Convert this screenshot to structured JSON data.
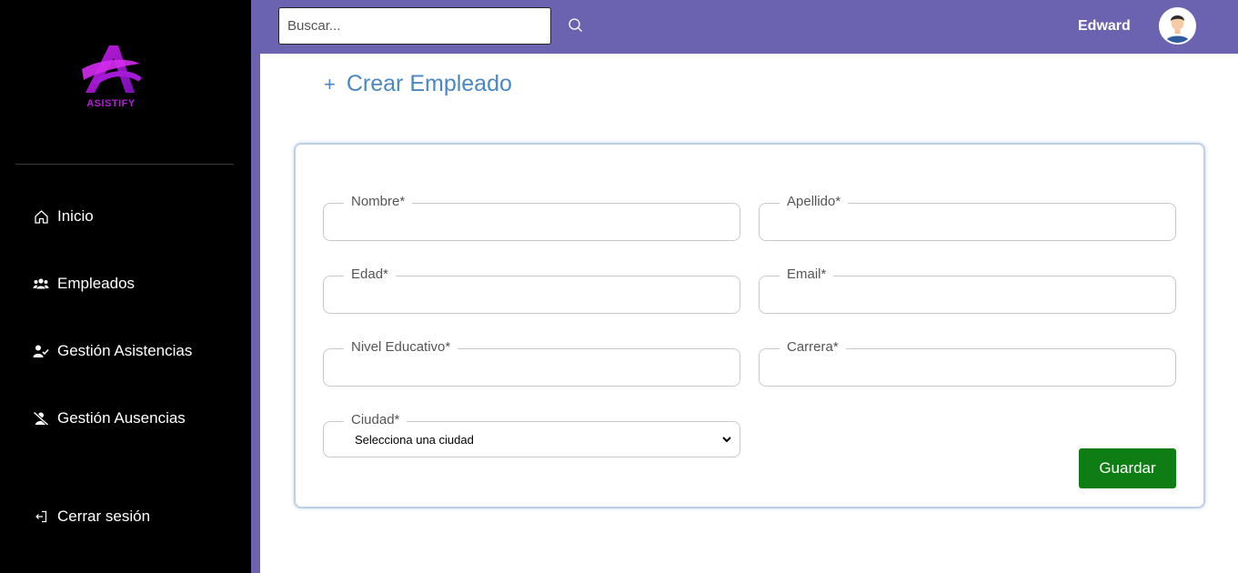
{
  "brand": {
    "name": "ASISTIFY"
  },
  "sidebar": {
    "items": [
      {
        "label": "Inicio",
        "icon": "home-icon"
      },
      {
        "label": "Empleados",
        "icon": "users-icon"
      },
      {
        "label": "Gestión Asistencias",
        "icon": "user-check-icon"
      },
      {
        "label": "Gestión Ausencias",
        "icon": "user-slash-icon"
      }
    ],
    "logout": {
      "label": "Cerrar sesión",
      "icon": "logout-icon"
    }
  },
  "topbar": {
    "search_placeholder": "Buscar...",
    "search_icon": "search-icon",
    "username": "Edward",
    "avatar_icon": "user-avatar"
  },
  "page": {
    "title": "Crear Empleado",
    "title_icon": "plus-icon"
  },
  "form": {
    "nombre": {
      "label": "Nombre*",
      "value": ""
    },
    "apellido": {
      "label": "Apellido*",
      "value": ""
    },
    "edad": {
      "label": "Edad*",
      "value": ""
    },
    "email": {
      "label": "Email*",
      "value": ""
    },
    "nivel": {
      "label": "Nivel Educativo*",
      "value": ""
    },
    "carrera": {
      "label": "Carrera*",
      "value": ""
    },
    "ciudad": {
      "label": "Ciudad*",
      "selected": "Selecciona una ciudad"
    },
    "save_label": "Guardar"
  },
  "colors": {
    "sidebar_bg": "#000000",
    "topbar_bg": "#6c63b0",
    "title_color": "#4a88c4",
    "save_bg": "#0e7d13",
    "brand_color": "#b51ed8"
  }
}
